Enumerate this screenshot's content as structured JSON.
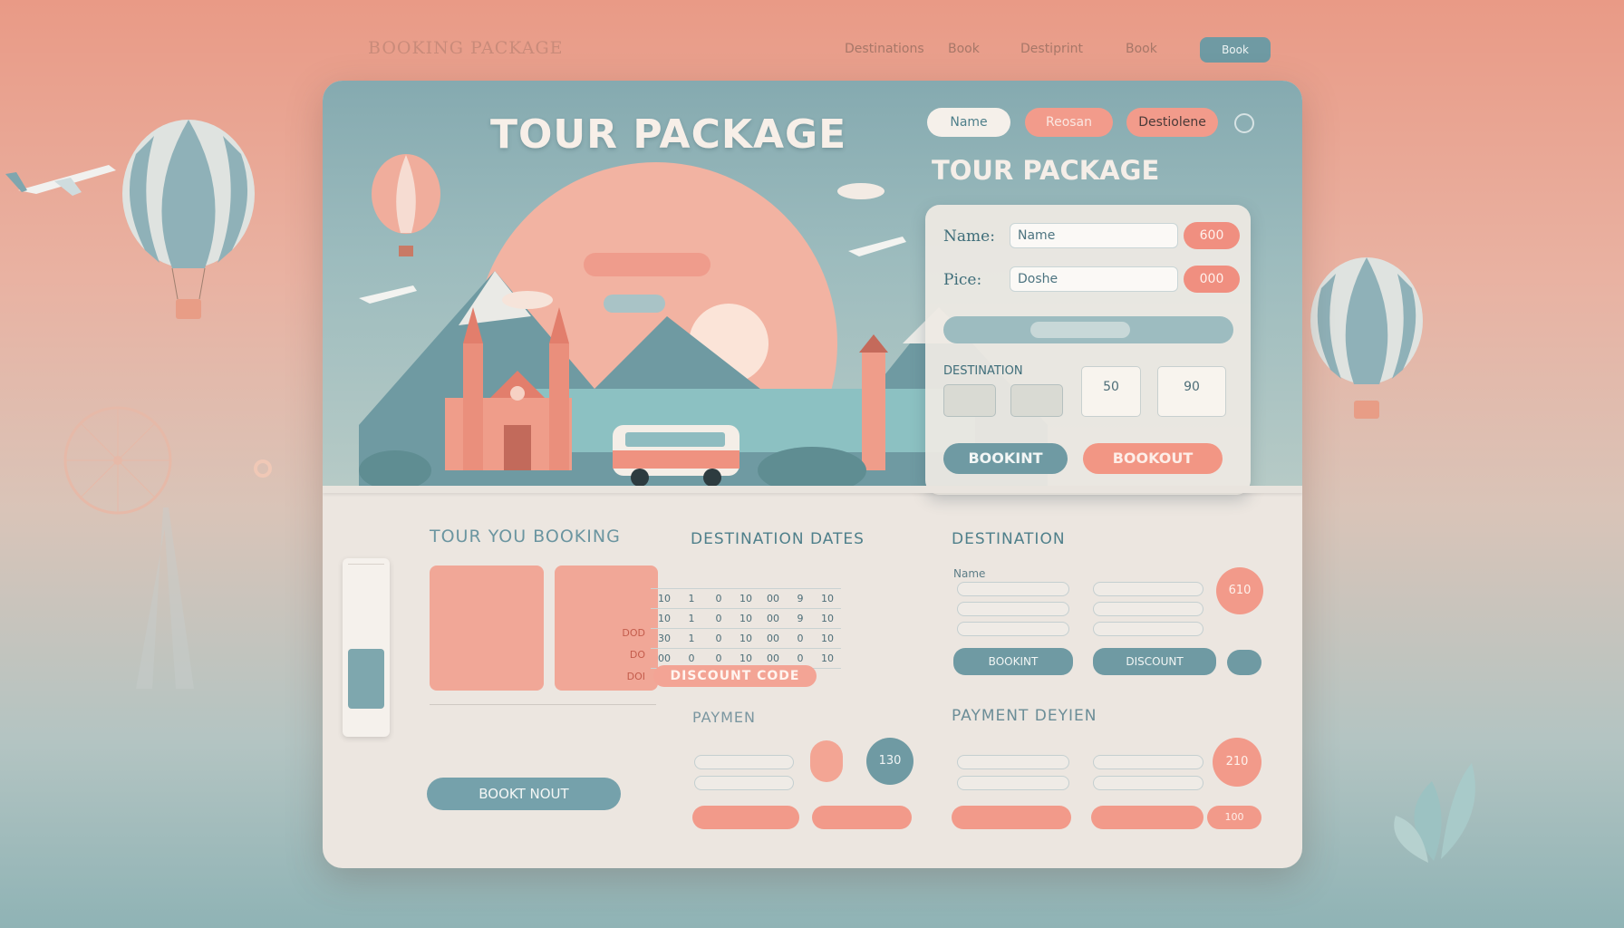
{
  "nav": {
    "brand": "BOOKING PACKAGE",
    "links": [
      "",
      "Destinations",
      "Book",
      "Destiprint",
      "Book"
    ],
    "cta": "Book"
  },
  "hero": {
    "tiny": "",
    "title": "TOUR PACKAGE",
    "paragraph": "",
    "pill_primary": "",
    "pill_secondary": ""
  },
  "top_pills": [
    "Name",
    "Reosan",
    "Destiolene"
  ],
  "form": {
    "title": "TOUR PACKAGE",
    "name_label": "Name:",
    "name_value": "Name",
    "name_badge": "600",
    "price_label": "Pice:",
    "price_value": "Doshe",
    "price_badge": "000",
    "slider_left": "",
    "slider_right": "",
    "destination_label": "DESTINATION",
    "mini_buttons": [
      "",
      ""
    ],
    "small_fields": [
      {
        "label": "",
        "value": "50"
      },
      {
        "label": "",
        "value": "90"
      }
    ],
    "btn_book": "BOOKINT",
    "btn_bookout": "BOOKOUT"
  },
  "booking": {
    "heading": "TOUR YOU BOOKING",
    "card1_rows": [
      "",
      "",
      "",
      "",
      ""
    ],
    "card2_rows": [
      {
        "label": "",
        "value": ""
      },
      {
        "label": "",
        "value": "DOD"
      },
      {
        "label": "",
        "value": "DO"
      },
      {
        "label": "",
        "value": "DOI"
      }
    ],
    "paragraph": "",
    "button": "BOOKT NOUT"
  },
  "dates": {
    "heading": "DESTINATION DATES",
    "header_row": [
      "",
      "",
      "",
      "",
      "",
      "",
      ""
    ],
    "rows": [
      [
        "10",
        "1",
        "0",
        "10",
        "00",
        "9",
        "10"
      ],
      [
        "10",
        "1",
        "0",
        "10",
        "00",
        "9",
        "10"
      ],
      [
        "30",
        "1",
        "0",
        "10",
        "00",
        "0",
        "10"
      ],
      [
        "00",
        "0",
        "0",
        "10",
        "00",
        "0",
        "10"
      ]
    ],
    "discount": "DISCOUNT CODE",
    "payment_heading": "PAYMEN",
    "payment_label": "",
    "pay_badge1": "",
    "pay_badge2": "130",
    "pay_btn1": "",
    "pay_btn2": ""
  },
  "destination": {
    "heading": "DESTINATION",
    "col1_label": "Name",
    "col2_label": "",
    "badge": "610",
    "btn1": "BOOKINT",
    "btn2": "DISCOUNT",
    "payment_heading": "PAYMENT DEYIEN",
    "pay_badge": "210",
    "pay_btn1": "",
    "pay_btn2": "",
    "pay_btn3": "100"
  },
  "colors": {
    "coral": "#f08f80",
    "teal": "#75a1ab",
    "cream": "#ece6e0"
  }
}
